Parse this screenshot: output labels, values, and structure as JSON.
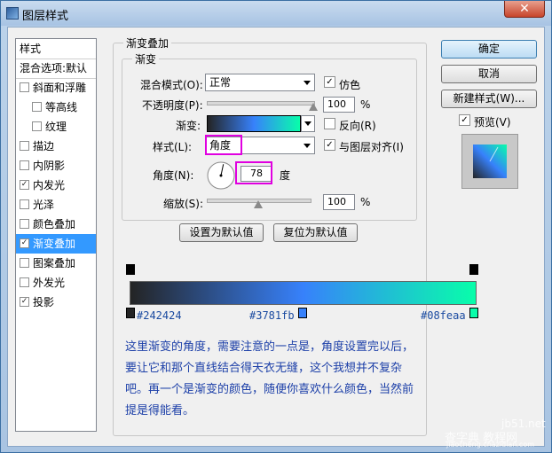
{
  "window": {
    "title": "图层样式",
    "close": "✕"
  },
  "sidebar": {
    "items": [
      {
        "label": "样式",
        "checkbox": false
      },
      {
        "label": "混合选项:默认",
        "checkbox": false
      },
      {
        "label": "斜面和浮雕",
        "checkbox": true,
        "checked": false
      },
      {
        "label": "等高线",
        "checkbox": true,
        "checked": false,
        "indent": true
      },
      {
        "label": "纹理",
        "checkbox": true,
        "checked": false,
        "indent": true
      },
      {
        "label": "描边",
        "checkbox": true,
        "checked": false
      },
      {
        "label": "内阴影",
        "checkbox": true,
        "checked": false
      },
      {
        "label": "内发光",
        "checkbox": true,
        "checked": true
      },
      {
        "label": "光泽",
        "checkbox": true,
        "checked": false
      },
      {
        "label": "颜色叠加",
        "checkbox": true,
        "checked": false
      },
      {
        "label": "渐变叠加",
        "checkbox": true,
        "checked": true,
        "selected": true
      },
      {
        "label": "图案叠加",
        "checkbox": true,
        "checked": false
      },
      {
        "label": "外发光",
        "checkbox": true,
        "checked": false
      },
      {
        "label": "投影",
        "checkbox": true,
        "checked": true
      }
    ]
  },
  "panel": {
    "outer_title": "渐变叠加",
    "inner_title": "渐变",
    "blend_mode_label": "混合模式(O):",
    "blend_mode_value": "正常",
    "dither_label": "仿色",
    "opacity_label": "不透明度(P):",
    "opacity_value": "100",
    "opacity_unit": "%",
    "gradient_label": "渐变:",
    "reverse_label": "反向(R)",
    "style_label": "样式(L):",
    "style_value": "角度",
    "align_label": "与图层对齐(I)",
    "angle_label": "角度(N):",
    "angle_value": "78",
    "angle_unit": "度",
    "scale_label": "缩放(S):",
    "scale_value": "100",
    "scale_unit": "%",
    "set_default": "设置为默认值",
    "reset_default": "复位为默认值"
  },
  "controls": {
    "opacity_level": 1.0,
    "scale_level": 0.5,
    "angle_degrees": 78
  },
  "buttons": {
    "ok": "确定",
    "cancel": "取消",
    "new_style": "新建样式(W)...",
    "preview": "预览(V)"
  },
  "gradient": {
    "stops": [
      {
        "hex": "#242424",
        "color": "#242424"
      },
      {
        "hex": "#3781fb",
        "color": "#3781fb"
      },
      {
        "hex": "#08feaa",
        "color": "#08feaa"
      }
    ]
  },
  "note": {
    "text": "这里渐变的角度，需要注意的一点是，角度设置完以后，要让它和那个直线结合得天衣无缝，这个我想并不复杂吧。再一个是渐变的颜色，随便你喜欢什么颜色，当然前提是得能看。"
  },
  "watermark": {
    "site": "jb51.net",
    "brand": "查字典 教程网",
    "url": "jiaocheng.chazidian.com"
  }
}
